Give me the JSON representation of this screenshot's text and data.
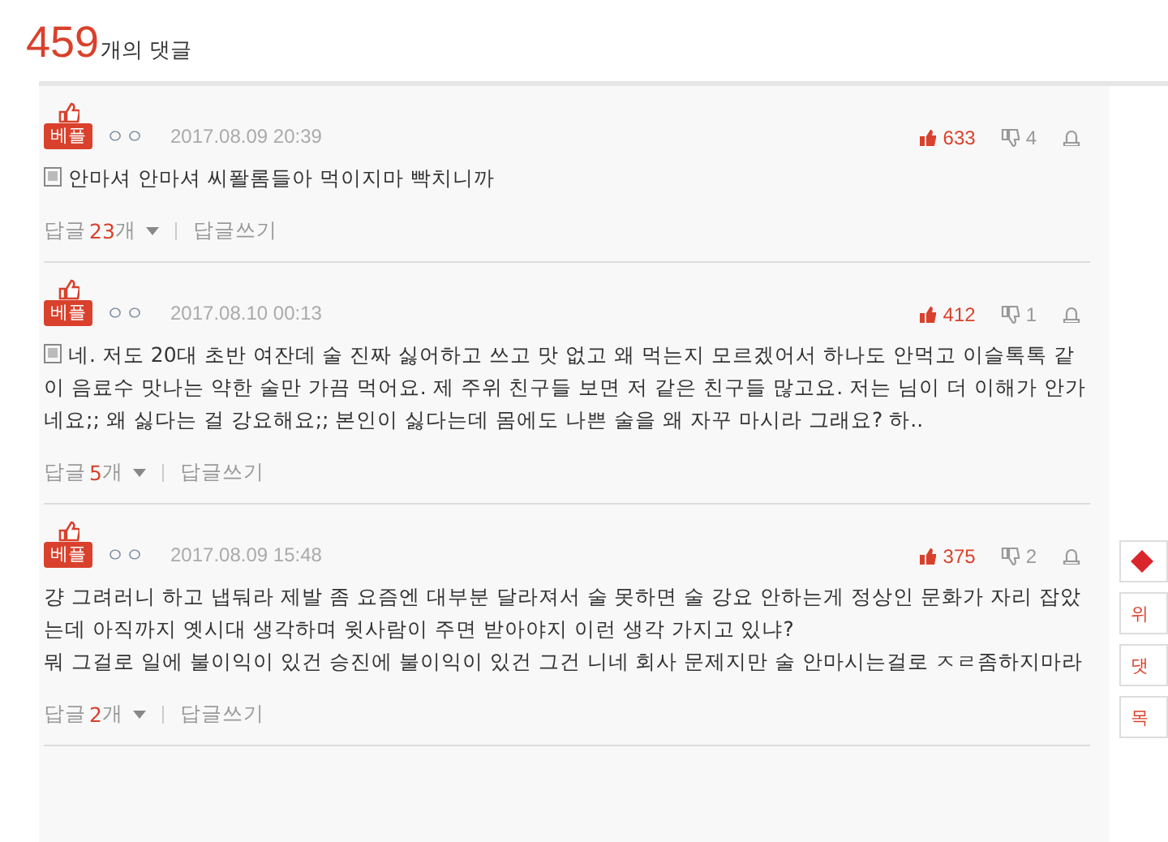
{
  "header": {
    "count": "459",
    "label": "개의 댓글"
  },
  "comments": [
    {
      "badge": "베플",
      "author": "ㅇㅇ",
      "date": "2017.08.09 20:39",
      "mobile": true,
      "text": "안마셔 안마셔 씨퐐롬들아 먹이지마 빡치니까",
      "likes": "633",
      "dislikes": "4",
      "reply_label": "답글",
      "reply_count": "23",
      "reply_unit": "개",
      "write": "답글쓰기"
    },
    {
      "badge": "베플",
      "author": "ㅇㅇ",
      "date": "2017.08.10 00:13",
      "mobile": true,
      "text": "네. 저도 20대 초반 여잔데 술 진짜 싫어하고 쓰고 맛 없고 왜 먹는지 모르겠어서 하나도 안먹고 이슬톡톡 같이 음료수 맛나는 약한 술만 가끔 먹어요. 제 주위 친구들 보면 저 같은 친구들 많고요. 저는 님이 더 이해가 안가네요;; 왜 싫다는 걸 강요해요;; 본인이 싫다는데 몸에도 나쁜 술을 왜 자꾸 마시라 그래요? 하..",
      "likes": "412",
      "dislikes": "1",
      "reply_label": "답글",
      "reply_count": "5",
      "reply_unit": "개",
      "write": "답글쓰기"
    },
    {
      "badge": "베플",
      "author": "ㅇㅇ",
      "date": "2017.08.09 15:48",
      "mobile": false,
      "text": "걍 그려러니 하고 냅둬라 제발 좀 요즘엔 대부분 달라져서 술 못하면 술 강요 안하는게 정상인 문화가 자리 잡았는데 아직까지 옛시대 생각하며 윗사람이 주면 받아야지 이런 생각 가지고 있냐?\n뭐 그걸로 일에 불이익이 있건 승진에 불이익이 있건 그건 니네 회사 문제지만 술 안마시는걸로 ㅈㄹ좀하지마라",
      "likes": "375",
      "dislikes": "2",
      "reply_label": "답글",
      "reply_count": "2",
      "reply_unit": "개",
      "write": "답글쓰기"
    }
  ],
  "side_buttons": [
    {
      "kind": "icon"
    },
    {
      "kind": "text",
      "label": "위"
    },
    {
      "kind": "text",
      "label": "댓"
    },
    {
      "kind": "text",
      "label": "목"
    }
  ]
}
